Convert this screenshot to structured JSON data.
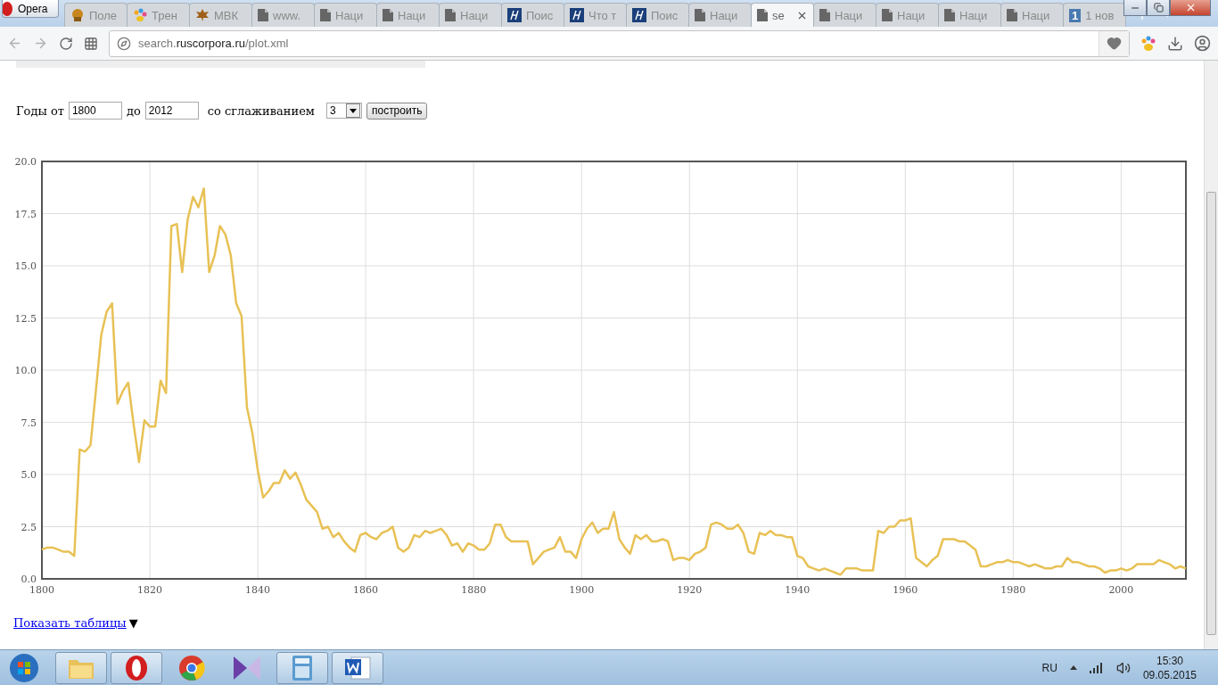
{
  "browser": {
    "opera_button": "Opera",
    "tabs": [
      {
        "label": "Поле",
        "kind": "muffin",
        "selected": false
      },
      {
        "label": "Трен",
        "kind": "paw",
        "selected": false
      },
      {
        "label": "МВК",
        "kind": "leaf",
        "selected": false
      },
      {
        "label": "www.",
        "kind": "page",
        "selected": false
      },
      {
        "label": "Наци",
        "kind": "page",
        "selected": false
      },
      {
        "label": "Наци",
        "kind": "page",
        "selected": false
      },
      {
        "label": "Наци",
        "kind": "page",
        "selected": false
      },
      {
        "label": "Поис",
        "kind": "corpus",
        "selected": false
      },
      {
        "label": "Что т",
        "kind": "corpus",
        "selected": false
      },
      {
        "label": "Поис",
        "kind": "corpus",
        "selected": false
      },
      {
        "label": "Наци",
        "kind": "page",
        "selected": false
      },
      {
        "label": "se",
        "kind": "page",
        "selected": true
      },
      {
        "label": "Наци",
        "kind": "page",
        "selected": false
      },
      {
        "label": "Наци",
        "kind": "page",
        "selected": false
      },
      {
        "label": "Наци",
        "kind": "page",
        "selected": false
      },
      {
        "label": "Наци",
        "kind": "page",
        "selected": false
      },
      {
        "label": "1 нов",
        "kind": "number",
        "badge": "1",
        "selected": false
      }
    ],
    "address": {
      "prefix": "search.",
      "domain": "ruscorpora.ru",
      "path": "/plot.xml"
    }
  },
  "form": {
    "from_label": "Годы от",
    "from_value": "1800",
    "to_label": "до",
    "to_value": "2012",
    "smoothing_label": "со сглаживанием",
    "smoothing_value": "3",
    "submit": "построить"
  },
  "chart": {
    "chart_data": {
      "type": "line",
      "grid": true,
      "xlim": [
        1800,
        2012
      ],
      "ylim": [
        0,
        20
      ],
      "x": [
        1800,
        1801,
        1802,
        1803,
        1804,
        1805,
        1806,
        1807,
        1808,
        1809,
        1810,
        1811,
        1812,
        1813,
        1814,
        1815,
        1816,
        1817,
        1818,
        1819,
        1820,
        1821,
        1822,
        1823,
        1824,
        1825,
        1826,
        1827,
        1828,
        1829,
        1830,
        1831,
        1832,
        1833,
        1834,
        1835,
        1836,
        1837,
        1838,
        1839,
        1840,
        1841,
        1842,
        1843,
        1844,
        1845,
        1846,
        1847,
        1848,
        1849,
        1850,
        1851,
        1852,
        1853,
        1854,
        1855,
        1856,
        1857,
        1858,
        1859,
        1860,
        1861,
        1862,
        1863,
        1864,
        1865,
        1866,
        1867,
        1868,
        1869,
        1870,
        1871,
        1872,
        1873,
        1874,
        1875,
        1876,
        1877,
        1878,
        1879,
        1880,
        1881,
        1882,
        1883,
        1884,
        1885,
        1886,
        1887,
        1888,
        1889,
        1890,
        1891,
        1892,
        1893,
        1894,
        1895,
        1896,
        1897,
        1898,
        1899,
        1900,
        1901,
        1902,
        1903,
        1904,
        1905,
        1906,
        1907,
        1908,
        1909,
        1910,
        1911,
        1912,
        1913,
        1914,
        1915,
        1916,
        1917,
        1918,
        1919,
        1920,
        1921,
        1922,
        1923,
        1924,
        1925,
        1926,
        1927,
        1928,
        1929,
        1930,
        1931,
        1932,
        1933,
        1934,
        1935,
        1936,
        1937,
        1938,
        1939,
        1940,
        1941,
        1942,
        1943,
        1944,
        1945,
        1946,
        1947,
        1948,
        1949,
        1950,
        1951,
        1952,
        1953,
        1954,
        1955,
        1956,
        1957,
        1958,
        1959,
        1960,
        1961,
        1962,
        1963,
        1964,
        1965,
        1966,
        1967,
        1968,
        1969,
        1970,
        1971,
        1972,
        1973,
        1974,
        1975,
        1976,
        1977,
        1978,
        1979,
        1980,
        1981,
        1982,
        1983,
        1984,
        1985,
        1986,
        1987,
        1988,
        1989,
        1990,
        1991,
        1992,
        1993,
        1994,
        1995,
        1996,
        1997,
        1998,
        1999,
        2000,
        2001,
        2002,
        2003,
        2004,
        2005,
        2006,
        2007,
        2008,
        2009,
        2010,
        2011,
        2012
      ],
      "xticks": [
        1800,
        1820,
        1840,
        1860,
        1880,
        1900,
        1920,
        1940,
        1960,
        1980,
        2000
      ],
      "yticks": [
        {
          "value": 0,
          "label": "0.0"
        },
        {
          "value": 2.5,
          "label": "2.5"
        },
        {
          "value": 5,
          "label": "5.0"
        },
        {
          "value": 7.5,
          "label": "7.5"
        },
        {
          "value": 10,
          "label": "10.0"
        },
        {
          "value": 12.5,
          "label": "12.5"
        },
        {
          "value": 15,
          "label": "15.0"
        },
        {
          "value": 17.5,
          "label": "17.5"
        },
        {
          "value": 20,
          "label": "20.0"
        }
      ],
      "series": [
        {
          "color": "#e8c155",
          "values": [
            1.4,
            1.5,
            1.5,
            1.4,
            1.3,
            1.3,
            1.1,
            6.2,
            6.1,
            6.4,
            9.0,
            11.7,
            12.8,
            13.2,
            8.4,
            9.0,
            9.4,
            7.4,
            5.6,
            7.6,
            7.3,
            7.3,
            9.5,
            8.9,
            16.9,
            17.0,
            14.7,
            17.2,
            18.3,
            17.8,
            18.7,
            14.7,
            15.5,
            16.9,
            16.5,
            15.5,
            13.2,
            12.6,
            8.2,
            7.0,
            5.2,
            3.9,
            4.2,
            4.6,
            4.6,
            5.2,
            4.8,
            5.1,
            4.5,
            3.8,
            3.5,
            3.2,
            2.4,
            2.5,
            2.0,
            2.2,
            1.8,
            1.5,
            1.3,
            2.1,
            2.2,
            2.0,
            1.9,
            2.2,
            2.3,
            2.5,
            1.5,
            1.3,
            1.5,
            2.1,
            2.0,
            2.3,
            2.2,
            2.3,
            2.4,
            2.1,
            1.6,
            1.7,
            1.3,
            1.7,
            1.6,
            1.4,
            1.4,
            1.7,
            2.6,
            2.6,
            2.0,
            1.8,
            1.8,
            1.8,
            1.8,
            0.7,
            1.0,
            1.3,
            1.4,
            1.5,
            2.0,
            1.3,
            1.3,
            1.0,
            1.9,
            2.4,
            2.7,
            2.2,
            2.4,
            2.4,
            3.2,
            1.9,
            1.5,
            1.2,
            2.1,
            1.9,
            2.1,
            1.8,
            1.8,
            1.9,
            1.8,
            0.9,
            1.0,
            1.0,
            0.9,
            1.2,
            1.3,
            1.5,
            2.6,
            2.7,
            2.6,
            2.4,
            2.4,
            2.6,
            2.2,
            1.3,
            1.2,
            2.2,
            2.1,
            2.3,
            2.1,
            2.1,
            2.0,
            2.0,
            1.1,
            1.0,
            0.6,
            0.5,
            0.4,
            0.5,
            0.4,
            0.3,
            0.2,
            0.5,
            0.5,
            0.5,
            0.4,
            0.4,
            0.4,
            2.3,
            2.2,
            2.5,
            2.5,
            2.8,
            2.8,
            2.9,
            1.0,
            0.8,
            0.6,
            0.9,
            1.1,
            1.9,
            1.9,
            1.9,
            1.8,
            1.8,
            1.6,
            1.4,
            0.6,
            0.6,
            0.7,
            0.8,
            0.8,
            0.9,
            0.8,
            0.8,
            0.7,
            0.6,
            0.7,
            0.6,
            0.5,
            0.5,
            0.6,
            0.6,
            1.0,
            0.8,
            0.8,
            0.7,
            0.6,
            0.6,
            0.5,
            0.3,
            0.4,
            0.4,
            0.5,
            0.4,
            0.5,
            0.7,
            0.7,
            0.7,
            0.7,
            0.9,
            0.8,
            0.7,
            0.5,
            0.6,
            0.5
          ]
        }
      ]
    }
  },
  "show_tables": {
    "link": "Показать таблицы",
    "arrow": "▼"
  },
  "taskbar": {
    "apps": [
      {
        "kind": "folder",
        "running": true
      },
      {
        "kind": "opera",
        "running": true
      },
      {
        "kind": "chrome",
        "running": false
      },
      {
        "kind": "studio",
        "running": false
      },
      {
        "kind": "calculator",
        "running": true
      },
      {
        "kind": "word",
        "running": true
      }
    ],
    "language": "RU",
    "time": "15:30",
    "date": "09.05.2015"
  }
}
